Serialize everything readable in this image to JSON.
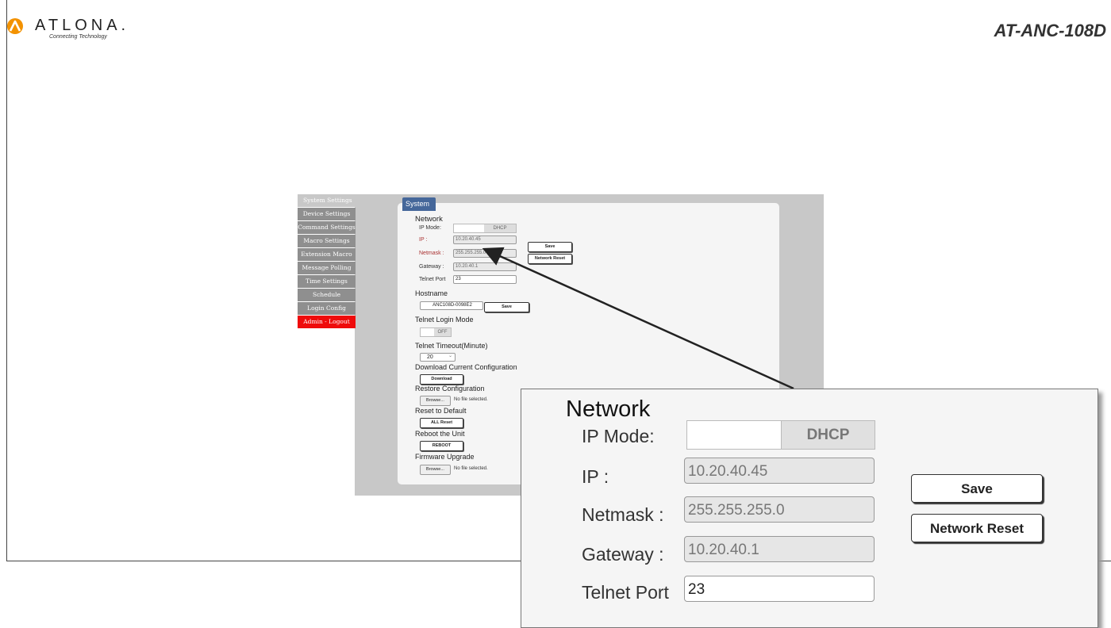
{
  "header": {
    "brand": "ATLONA.",
    "tagline": "Connecting Technology",
    "model": "AT-ANC-108D"
  },
  "sidebar": {
    "items": [
      {
        "label": "System Settings"
      },
      {
        "label": "Device Settings"
      },
      {
        "label": "Command Settings"
      },
      {
        "label": "Macro Settings"
      },
      {
        "label": "Extension Macro"
      },
      {
        "label": "Message Polling"
      },
      {
        "label": "Time Settings"
      },
      {
        "label": "Schedule"
      },
      {
        "label": "Login Config"
      },
      {
        "label": "Admin - Logout"
      }
    ]
  },
  "system": {
    "tab": "System",
    "network": {
      "title": "Network",
      "ip_mode_label": "IP Mode:",
      "ip_mode_value": "DHCP",
      "ip_label": "IP :",
      "ip_value": "10.20.40.45",
      "netmask_label": "Netmask :",
      "netmask_value": "255.255.255.0",
      "gateway_label": "Gateway :",
      "gateway_value": "10.20.40.1",
      "telnet_port_label": "Telnet Port",
      "telnet_port_value": "23",
      "save_label": "Save",
      "reset_label": "Network Reset"
    },
    "hostname": {
      "title": "Hostname",
      "value": "ANC108D-0098E2",
      "save_label": "Save"
    },
    "telnet_login": {
      "title": "Telnet Login Mode",
      "value": "OFF"
    },
    "telnet_timeout": {
      "title": "Telnet Timeout(Minute)",
      "value": "20"
    },
    "download": {
      "title": "Download Current Configuration",
      "button": "Download"
    },
    "restore": {
      "title": "Restore Configuration",
      "browse": "Browse...",
      "status": "No file selected."
    },
    "reset": {
      "title": "Reset to Default",
      "button": "ALL Reset"
    },
    "reboot": {
      "title": "Reboot the Unit",
      "button": "REBOOT"
    },
    "firmware": {
      "title": "Firmware Upgrade",
      "browse": "Browse...",
      "status": "No file selected."
    }
  },
  "colors": {
    "tab": "#45679a",
    "logout": "#ef0b0b",
    "logo_orange": "#f39200"
  },
  "icons": {
    "logo": "atlona-logo-icon"
  }
}
